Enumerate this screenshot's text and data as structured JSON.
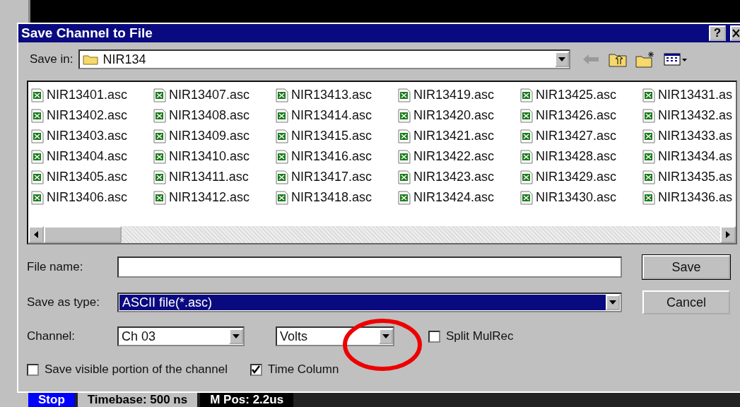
{
  "dialog": {
    "title": "Save Channel to File",
    "help_button": "?",
    "save_in": {
      "label": "Save in:",
      "value": "NIR134"
    },
    "files": [
      {
        "name": "NIR13401.asc"
      },
      {
        "name": "NIR13402.asc"
      },
      {
        "name": "NIR13403.asc"
      },
      {
        "name": "NIR13404.asc"
      },
      {
        "name": "NIR13405.asc"
      },
      {
        "name": "NIR13406.asc"
      },
      {
        "name": "NIR13407.asc"
      },
      {
        "name": "NIR13408.asc"
      },
      {
        "name": "NIR13409.asc"
      },
      {
        "name": "NIR13410.asc"
      },
      {
        "name": "NIR13411.asc"
      },
      {
        "name": "NIR13412.asc"
      },
      {
        "name": "NIR13413.asc"
      },
      {
        "name": "NIR13414.asc"
      },
      {
        "name": "NIR13415.asc"
      },
      {
        "name": "NIR13416.asc"
      },
      {
        "name": "NIR13417.asc"
      },
      {
        "name": "NIR13418.asc"
      },
      {
        "name": "NIR13419.asc"
      },
      {
        "name": "NIR13420.asc"
      },
      {
        "name": "NIR13421.asc"
      },
      {
        "name": "NIR13422.asc"
      },
      {
        "name": "NIR13423.asc"
      },
      {
        "name": "NIR13424.asc"
      },
      {
        "name": "NIR13425.asc"
      },
      {
        "name": "NIR13426.asc"
      },
      {
        "name": "NIR13427.asc"
      },
      {
        "name": "NIR13428.asc"
      },
      {
        "name": "NIR13429.asc"
      },
      {
        "name": "NIR13430.asc"
      },
      {
        "name": "NIR13431.as"
      },
      {
        "name": "NIR13432.as"
      },
      {
        "name": "NIR13433.as"
      },
      {
        "name": "NIR13434.as"
      },
      {
        "name": "NIR13435.as"
      },
      {
        "name": "NIR13436.as"
      }
    ],
    "file_name": {
      "label": "File name:"
    },
    "save_as_type": {
      "label": "Save as type:",
      "value": "ASCII file(*.asc)",
      "selected": true
    },
    "channel": {
      "label": "Channel:",
      "value": "Ch 03"
    },
    "units": {
      "value": "Volts"
    },
    "split_mulrec": {
      "label": "Split MulRec",
      "checked": false
    },
    "save_visible": {
      "label": "Save visible portion of the channel",
      "checked": false
    },
    "time_column": {
      "label": "Time Column",
      "checked": true
    },
    "buttons": [
      {
        "label": "Save",
        "default": true
      },
      {
        "label": "Cancel",
        "default": false
      }
    ]
  },
  "status_strip": [
    {
      "text": "Stop",
      "kind": "run"
    },
    {
      "text": "Timebase: 500 ns",
      "kind": "plain"
    },
    {
      "text": "M Pos: 2.2us",
      "kind": "dark"
    }
  ]
}
